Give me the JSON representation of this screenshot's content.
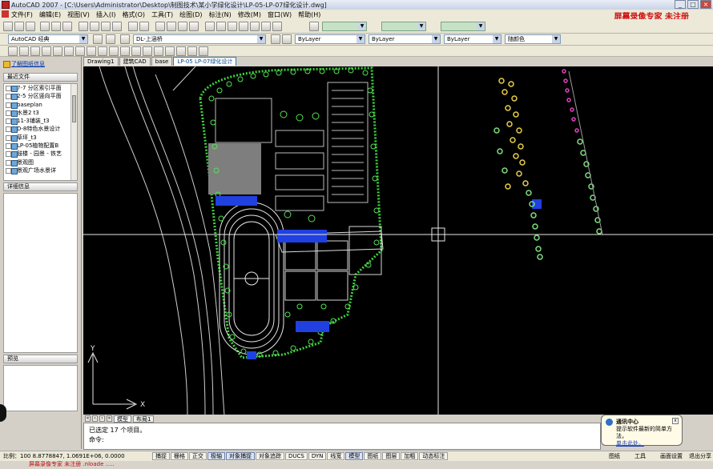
{
  "titlebar": {
    "app_title": "AutoCAD 2007 - [C:\\Users\\Administrator\\Desktop\\制图技术\\某小学绿化设计\\LP-05-LP-07绿化设计.dwg]",
    "minimize": "_",
    "maximize": "□",
    "close": "×"
  },
  "menubar": {
    "items": [
      "文件(F)",
      "编辑(E)",
      "视图(V)",
      "插入(I)",
      "格式(O)",
      "工具(T)",
      "绘图(D)",
      "标注(N)",
      "修改(M)",
      "窗口(W)",
      "帮助(H)"
    ]
  },
  "watermark": "屏幕录像专家 未注册",
  "toolbar": {
    "workspace": "AutoCAD 经典",
    "layer": "DL-上涵桥",
    "color": "ByLayer",
    "linetype": "ByLayer",
    "lineweight": "ByLayer",
    "plotstyle": "随颜色"
  },
  "left_panel": {
    "link": "了解图纸信息",
    "recent_header": "最近文件",
    "files": [
      "7-7 分区索引平面",
      "2-5 分区竖向平面",
      "baseplan",
      "水景2 t3",
      "11-3铺装_t3",
      "D-8特色水景设计",
      "草坪_t3",
      "LP-05植物配置B",
      "鼓楼 - 园景 - 铁艺",
      "景观图",
      "景观广场水景详"
    ],
    "detail_header": "详细信息",
    "preview_header": "预览"
  },
  "tabs": {
    "items": [
      "Drawing1",
      "建筑CAD",
      "base",
      "LP-05 LP-07绿化设计"
    ],
    "active_index": 3
  },
  "layout_tabs": {
    "model": "模型",
    "layout": "布局1"
  },
  "ucs": {
    "x_label": "X",
    "y_label": "Y"
  },
  "command": {
    "line1": "已选定 17 个项目。",
    "line2": "命令:"
  },
  "statusbar": {
    "scale": "比例：100",
    "coords": "8.8778847, 1.0691E+06, 0.0000",
    "toggles": [
      "捕捉",
      "栅格",
      "正交",
      "极轴",
      "对象捕捉",
      "对象追踪",
      "DUCS",
      "DYN",
      "线宽",
      "模型",
      "图纸",
      "图层",
      "加粗",
      "动态标注"
    ],
    "toggles_on": [
      3,
      4,
      9
    ],
    "right_items": [
      "图纸",
      "工具",
      "画面设置",
      "退出分享"
    ]
  },
  "bottom_strip": "屏幕录像专家 未注册 .nloade .....",
  "balloon": {
    "title": "通讯中心",
    "body": "提示软件最新的简单方法，",
    "link": "单击此处。",
    "close": "x"
  }
}
